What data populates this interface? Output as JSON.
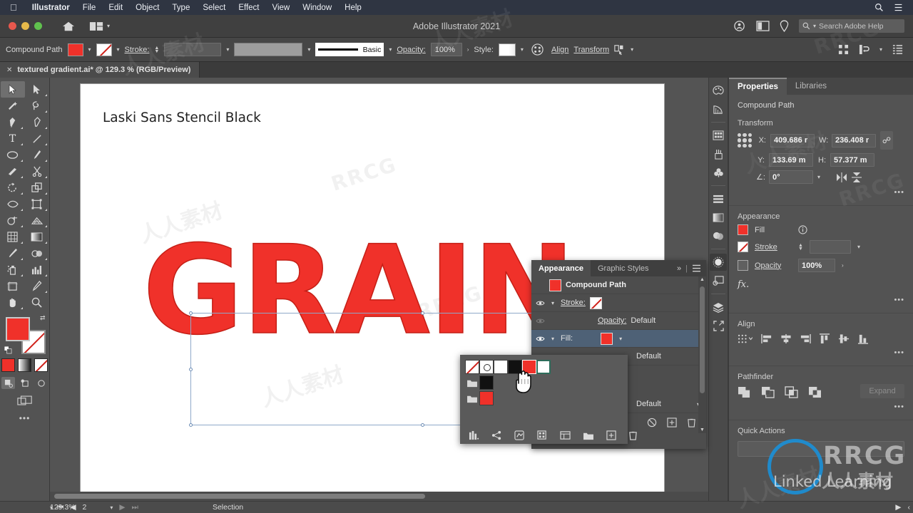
{
  "macmenu": {
    "apple": "apple-logo",
    "items": [
      "Illustrator",
      "File",
      "Edit",
      "Object",
      "Type",
      "Select",
      "Effect",
      "View",
      "Window",
      "Help"
    ]
  },
  "titlebar": {
    "title": "Adobe Illustrator 2021",
    "home_icon": "home-icon",
    "arrange_icon": "arrange-documents-icon",
    "search_placeholder": "Search Adobe Help",
    "cloud_icon": "cloud-sync-icon",
    "screen_icon": "screen-mode-icon",
    "discover_icon": "discover-icon"
  },
  "controlbar": {
    "object_label": "Compound Path",
    "fill_swatch": "red-fill-swatch",
    "stroke_swatch": "none-stroke-swatch",
    "stroke_label": "Stroke:",
    "stroke_weight": "",
    "brush_label": "Basic",
    "opacity_label": "Opacity:",
    "opacity_value": "100%",
    "style_label": "Style:",
    "align_label": "Align",
    "transform_label": "Transform",
    "recolor_icon": "recolor-artwork-icon",
    "select_similar_icon": "select-similar-icon",
    "arrange_icon": "arrange-icon",
    "workspace_icon": "workspace-switcher-icon",
    "doc_setup_icon": "document-setup-icon"
  },
  "doctab": {
    "close": "✕",
    "title": "textured gradient.ai* @ 129.3 % (RGB/Preview)"
  },
  "tools": {
    "items": [
      {
        "name": "selection-tool",
        "glyph": "selection",
        "selected": true
      },
      {
        "name": "direct-selection-tool",
        "glyph": "direct-selection",
        "selected": false
      },
      {
        "name": "magic-wand-tool",
        "glyph": "magic-wand",
        "selected": false
      },
      {
        "name": "lasso-tool",
        "glyph": "lasso",
        "selected": false
      },
      {
        "name": "pen-tool",
        "glyph": "pen",
        "selected": false
      },
      {
        "name": "curvature-tool",
        "glyph": "curvature",
        "selected": false
      },
      {
        "name": "type-tool",
        "glyph": "type",
        "selected": false
      },
      {
        "name": "line-segment-tool",
        "glyph": "line",
        "selected": false
      },
      {
        "name": "ellipse-tool",
        "glyph": "ellipse",
        "selected": false
      },
      {
        "name": "paintbrush-tool",
        "glyph": "paintbrush",
        "selected": false
      },
      {
        "name": "shaper-tool",
        "glyph": "shaper",
        "selected": false
      },
      {
        "name": "scissors-tool",
        "glyph": "scissors",
        "selected": false
      },
      {
        "name": "rotate-tool",
        "glyph": "rotate",
        "selected": false
      },
      {
        "name": "scale-tool",
        "glyph": "scale",
        "selected": false
      },
      {
        "name": "width-tool",
        "glyph": "width",
        "selected": false
      },
      {
        "name": "free-transform-tool",
        "glyph": "free-transform",
        "selected": false
      },
      {
        "name": "shape-builder-tool",
        "glyph": "shape-builder",
        "selected": false
      },
      {
        "name": "perspective-grid-tool",
        "glyph": "perspective",
        "selected": false
      },
      {
        "name": "mesh-tool",
        "glyph": "mesh",
        "selected": false
      },
      {
        "name": "gradient-tool",
        "glyph": "gradient",
        "selected": false
      },
      {
        "name": "eyedropper-tool",
        "glyph": "eyedropper",
        "selected": false
      },
      {
        "name": "blend-tool",
        "glyph": "blend",
        "selected": false
      },
      {
        "name": "symbol-sprayer-tool",
        "glyph": "symbol-sprayer",
        "selected": false
      },
      {
        "name": "column-graph-tool",
        "glyph": "graph",
        "selected": false
      },
      {
        "name": "artboard-tool",
        "glyph": "artboard",
        "selected": false
      },
      {
        "name": "slice-tool",
        "glyph": "slice",
        "selected": false
      },
      {
        "name": "hand-tool",
        "glyph": "hand",
        "selected": false
      },
      {
        "name": "zoom-tool",
        "glyph": "zoom",
        "selected": false
      }
    ],
    "fill_color": "#f0312a",
    "stroke_color": "none",
    "color_modes": [
      "color-mode",
      "gradient-mode",
      "none-mode"
    ],
    "draw_modes": [
      "draw-normal",
      "draw-behind",
      "draw-inside"
    ],
    "screen_mode": "change-screen-mode",
    "more_tools": "•••"
  },
  "canvas": {
    "artboard_label": "Laski Sans Stencil Black",
    "artwork_text": "GRAIN",
    "artwork_color": "#f0312a"
  },
  "properties": {
    "tabs": [
      {
        "label": "Properties",
        "active": true
      },
      {
        "label": "Libraries",
        "active": false
      }
    ],
    "object_type": "Compound Path",
    "transform": {
      "title": "Transform",
      "x_label": "X:",
      "x_value": "409.686 r",
      "y_label": "Y:",
      "y_value": "133.69 m",
      "w_label": "W:",
      "w_value": "236.408 r",
      "h_label": "H:",
      "h_value": "57.377 m",
      "angle_label": "∠:",
      "angle_value": "0°",
      "link_icon": "constrain-proportions-icon",
      "flip_h_icon": "flip-horizontal-icon",
      "flip_v_icon": "flip-vertical-icon",
      "more": "•••"
    },
    "appearance": {
      "title": "Appearance",
      "fill_label": "Fill",
      "stroke_label": "Stroke",
      "opacity_label": "Opacity",
      "opacity_value": "100%",
      "fx_label": "fx.",
      "info_icon": "info-icon",
      "more": "•••"
    },
    "align": {
      "title": "Align",
      "icons": [
        "align-to-selection",
        "align-left",
        "align-center-h",
        "align-right",
        "align-top",
        "align-center-v",
        "align-bottom"
      ],
      "more": "•••"
    },
    "pathfinder": {
      "title": "Pathfinder",
      "icons": [
        "unite",
        "minus-front",
        "intersect",
        "exclude"
      ],
      "expand_label": "Expand",
      "more": "•••"
    },
    "quick_actions": {
      "title": "Quick Actions"
    }
  },
  "rail": {
    "items": [
      "color-panel-icon",
      "color-guide-icon",
      "swatches-panel-icon",
      "brushes-panel-icon",
      "symbols-panel-icon",
      "align-panel-icon",
      "gradient-panel-icon",
      "transparency-panel-icon",
      "appearance-panel-icon",
      "graphic-styles-icon",
      "layers-panel-icon",
      "artboards-panel-icon"
    ]
  },
  "appearance_panel": {
    "tabs": [
      {
        "label": "Appearance",
        "active": true
      },
      {
        "label": "Graphic Styles",
        "active": false
      }
    ],
    "expand_icon": "»",
    "menu_icon": "panel-menu-icon",
    "rows": [
      {
        "name": "Compound Path",
        "type": "header",
        "swatch": "red"
      },
      {
        "name": "Stroke:",
        "type": "stroke",
        "swatch": "none",
        "eye": true,
        "twist": true
      },
      {
        "name": "Opacity:",
        "value": "Default",
        "type": "opacity",
        "eye": "dim"
      },
      {
        "name": "Fill:",
        "type": "fill",
        "swatch": "red",
        "eye": true,
        "twist": true,
        "selected": true
      },
      {
        "name": "Opacity:",
        "value": "Default",
        "type": "opacity-hidden"
      },
      {
        "name": "Opacity:",
        "value": "Default",
        "type": "opacity-hidden2"
      }
    ],
    "footer_icons": [
      "add-new-stroke-icon",
      "add-new-fill-icon",
      "add-new-effect-icon",
      "clear-appearance-icon",
      "duplicate-item-icon",
      "delete-item-icon"
    ],
    "inner_icons": [
      "no-appearance-icon",
      "duplicate-icon",
      "delete-icon"
    ]
  },
  "swatches_dropdown": {
    "swatches": [
      {
        "name": "swatch-none",
        "kind": "none"
      },
      {
        "name": "swatch-registration",
        "kind": "reg"
      },
      {
        "name": "swatch-white",
        "kind": "white"
      },
      {
        "name": "swatch-black",
        "kind": "black"
      },
      {
        "name": "swatch-red",
        "kind": "red"
      },
      {
        "name": "swatch-light",
        "kind": "light",
        "selected": true
      }
    ],
    "groups": [
      {
        "name": "swatch-group-grays",
        "swatch": "black"
      },
      {
        "name": "swatch-group-reds",
        "swatch": "red"
      }
    ],
    "footer_icons": [
      "swatch-libraries-icon",
      "show-swatch-kinds-icon",
      "swatch-options-icon",
      "new-color-group-icon",
      "new-swatch-icon",
      "delete-swatch-icon"
    ],
    "cursor": "hand-cursor"
  },
  "statusbar": {
    "zoom": "129.3%",
    "artboard_number": "2",
    "status_text": "Selection",
    "first_icon": "first-artboard-icon",
    "prev_icon": "previous-artboard-icon",
    "next_icon": "next-artboard-icon",
    "last_icon": "last-artboard-icon"
  },
  "watermarks": {
    "rrcg": "RRCG",
    "cn": "人人素材",
    "linkedin": "Linked Learning"
  }
}
